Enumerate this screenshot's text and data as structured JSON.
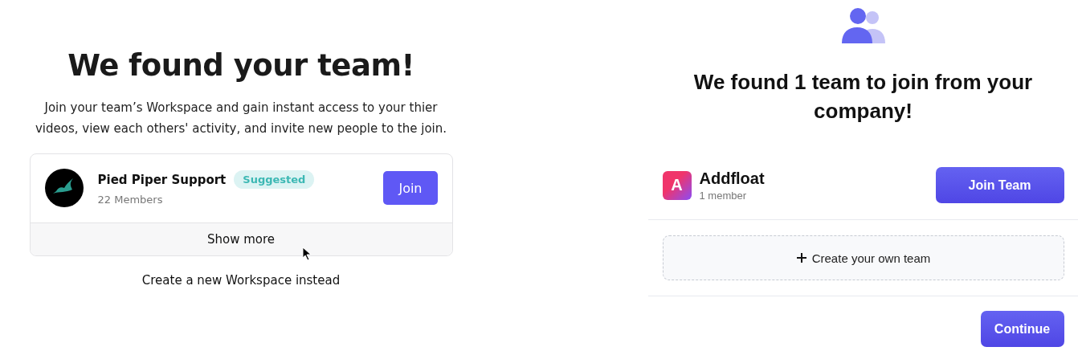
{
  "left": {
    "title": "We found your team!",
    "description": "Join your team’s Workspace and gain instant access to your thier videos, view each others' activity, and invite new people to the join.",
    "workspace": {
      "name": "Pied Piper Support",
      "badge": "Suggested",
      "members": "22 Members",
      "button": "Join"
    },
    "show_more": "Show more",
    "create_link": "Create a new Workspace instead"
  },
  "right": {
    "title": "We found 1 team to join from your company!",
    "team": {
      "initial": "A",
      "name": "Addfloat",
      "members": "1 member",
      "button": "Join Team"
    },
    "create_button": "Create your own team",
    "continue_button": "Continue"
  }
}
